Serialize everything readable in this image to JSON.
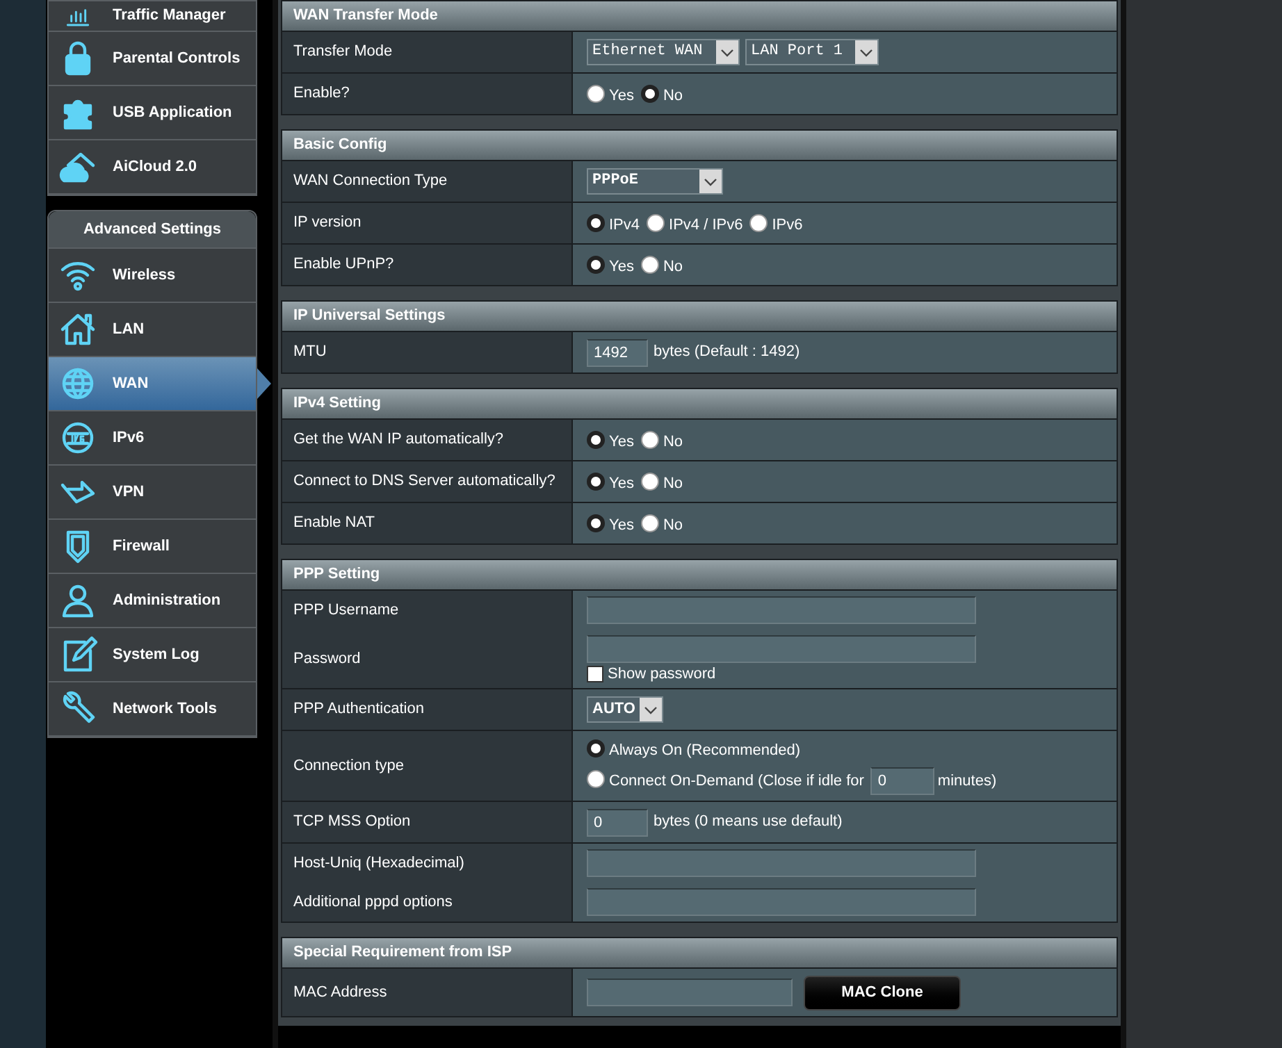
{
  "sidebar": {
    "general_items": [
      {
        "label": "Traffic Manager",
        "selected": false
      },
      {
        "label": "Parental Controls",
        "selected": false
      },
      {
        "label": "USB Application",
        "selected": false
      },
      {
        "label": "AiCloud 2.0",
        "selected": false
      }
    ],
    "advanced_title": "Advanced Settings",
    "advanced_items": [
      {
        "label": "Wireless",
        "selected": false
      },
      {
        "label": "LAN",
        "selected": false
      },
      {
        "label": "WAN",
        "selected": true
      },
      {
        "label": "IPv6",
        "selected": false
      },
      {
        "label": "VPN",
        "selected": false
      },
      {
        "label": "Firewall",
        "selected": false
      },
      {
        "label": "Administration",
        "selected": false
      },
      {
        "label": "System Log",
        "selected": false
      },
      {
        "label": "Network Tools",
        "selected": false
      }
    ]
  },
  "sections": [
    {
      "title": "WAN Transfer Mode",
      "rows": [
        {
          "kind": "select",
          "label": "Transfer Mode",
          "selects": [
            {
              "value": "Ethernet WAN"
            },
            {
              "value": "LAN Port 1"
            }
          ]
        },
        {
          "kind": "radio",
          "label": "Enable?",
          "options": [
            {
              "label": "Yes",
              "selected": false
            },
            {
              "label": "No",
              "selected": true
            }
          ]
        }
      ]
    },
    {
      "title": "Basic Config",
      "rows": [
        {
          "kind": "select",
          "label": "WAN Connection Type",
          "selects": [
            {
              "value": "PPPoE"
            }
          ]
        },
        {
          "kind": "radio",
          "label": "IP version",
          "options": [
            {
              "label": "IPv4",
              "selected": true
            },
            {
              "label": "IPv4 / IPv6",
              "selected": false
            },
            {
              "label": "IPv6",
              "selected": false
            }
          ]
        },
        {
          "kind": "radio",
          "label": "Enable UPnP?",
          "options": [
            {
              "label": "Yes",
              "selected": true
            },
            {
              "label": "No",
              "selected": false
            }
          ]
        }
      ]
    },
    {
      "title": "IP Universal Settings",
      "rows": [
        {
          "kind": "input",
          "label": "MTU",
          "value": "1492",
          "suffix": "bytes (Default : 1492)"
        }
      ]
    },
    {
      "title": "IPv4 Setting",
      "rows": [
        {
          "kind": "radio",
          "label": "Get the WAN IP automatically?",
          "options": [
            {
              "label": "Yes",
              "selected": true
            },
            {
              "label": "No",
              "selected": false
            }
          ]
        },
        {
          "kind": "radio",
          "label": "Connect to DNS Server automatically?",
          "options": [
            {
              "label": "Yes",
              "selected": true
            },
            {
              "label": "No",
              "selected": false
            }
          ]
        },
        {
          "kind": "radio",
          "label": "Enable NAT",
          "options": [
            {
              "label": "Yes",
              "selected": true
            },
            {
              "label": "No",
              "selected": false
            }
          ]
        }
      ]
    },
    {
      "title": "PPP Setting",
      "rows": [
        {
          "kind": "field_group",
          "fields": [
            {
              "label": "PPP Username"
            },
            {
              "label": "Password",
              "checkbox": {
                "label": "Show password",
                "checked": false
              }
            }
          ]
        },
        {
          "kind": "select",
          "label": "PPP Authentication",
          "selects": [
            {
              "value": "AUTO"
            }
          ]
        },
        {
          "kind": "radio_stack",
          "label": "Connection type",
          "options": [
            {
              "label": "Always On (Recommended)",
              "selected": true
            },
            {
              "label": "Connect On-Demand (Close if idle for",
              "value": "0",
              "suffix": "minutes)",
              "selected": false
            }
          ]
        },
        {
          "kind": "input",
          "label": "TCP MSS Option",
          "value": "0",
          "suffix": "bytes (0 means use default)"
        },
        {
          "kind": "field_group",
          "fields": [
            {
              "label": "Host-Uniq (Hexadecimal)"
            },
            {
              "label": "Additional pppd options"
            }
          ]
        }
      ]
    },
    {
      "title": "Special Requirement from ISP",
      "rows": [
        {
          "kind": "input_button",
          "label": "MAC Address",
          "button": "MAC Clone"
        }
      ]
    }
  ]
}
